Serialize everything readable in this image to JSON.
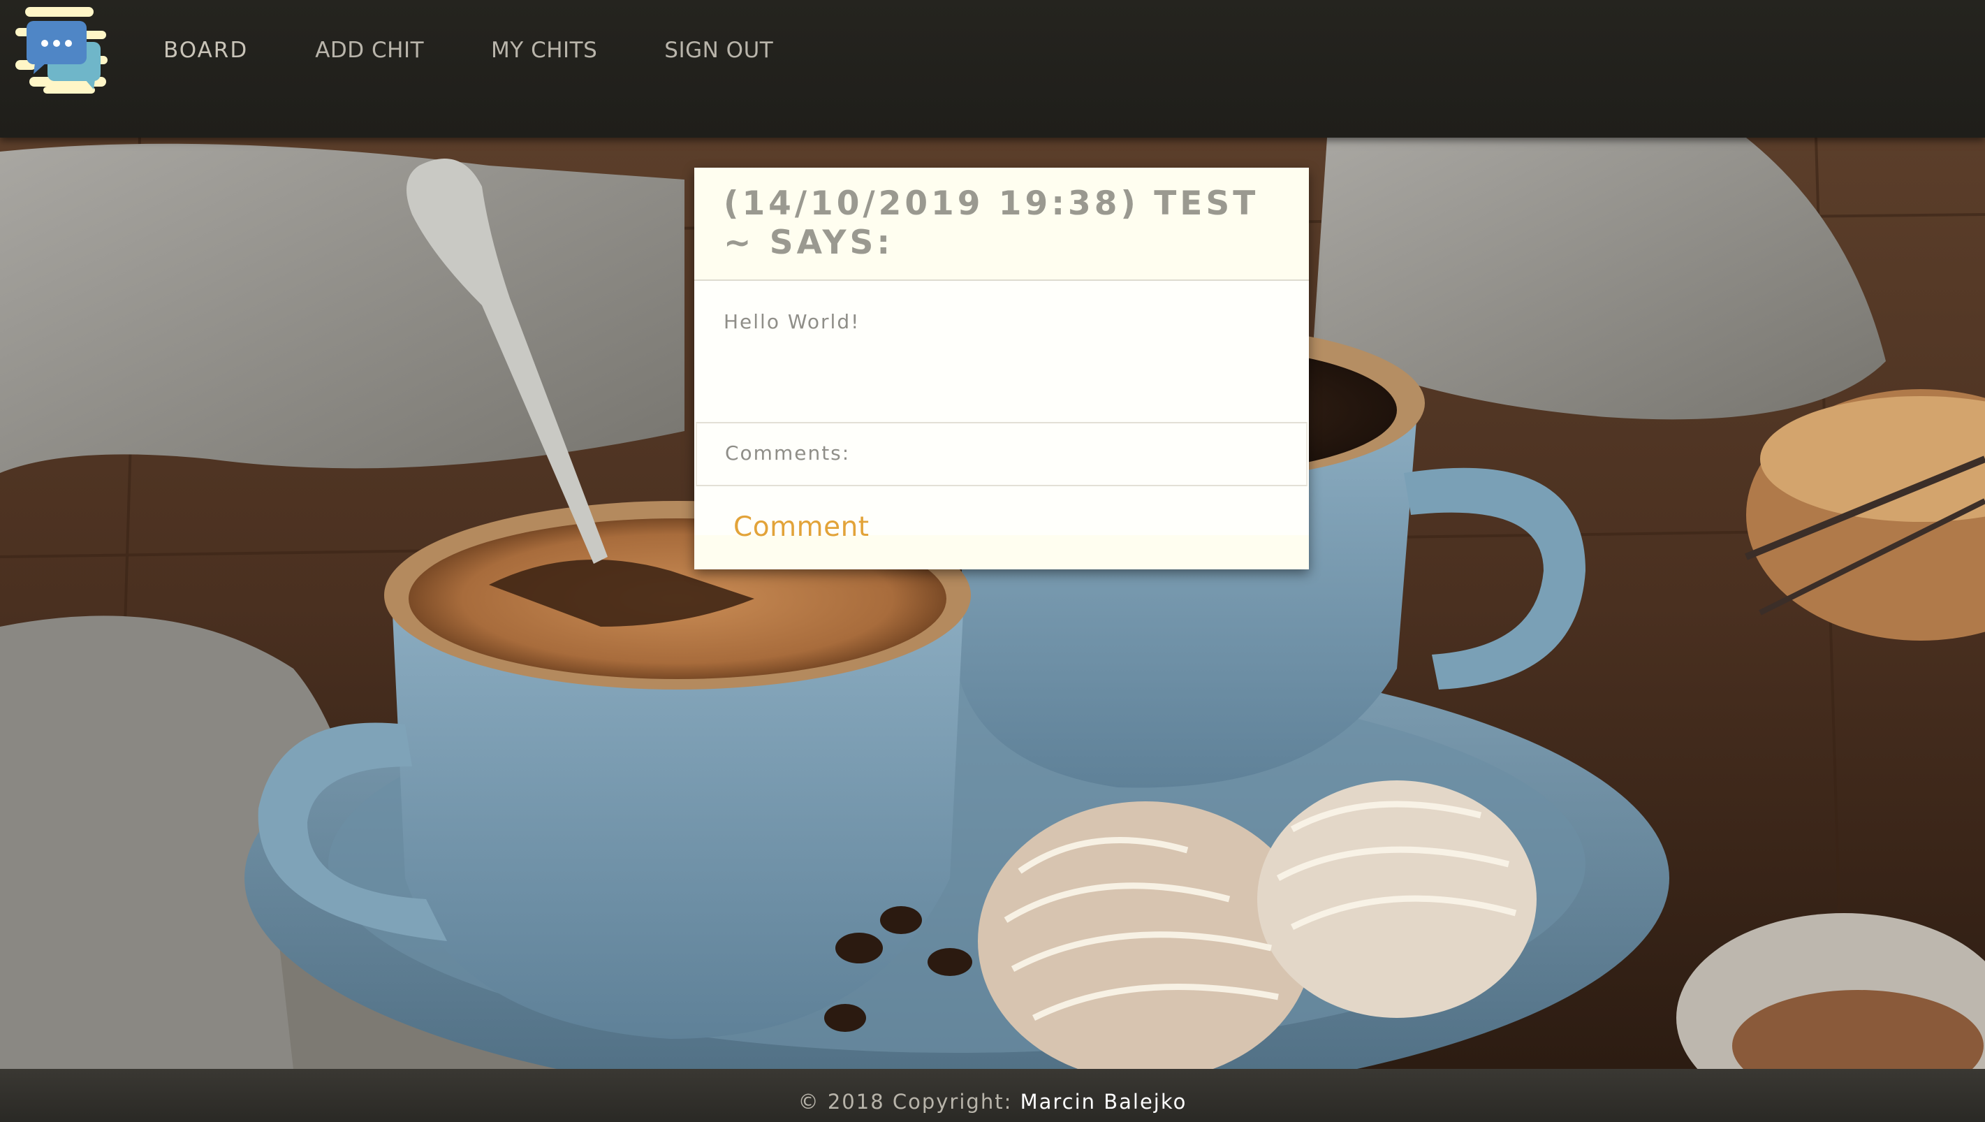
{
  "nav": {
    "logo_icon": "chat-bubbles-logo-icon",
    "items": [
      {
        "label": "BOARD"
      },
      {
        "label": "ADD CHIT"
      },
      {
        "label": "MY CHITS"
      },
      {
        "label": "SIGN OUT"
      }
    ]
  },
  "chit": {
    "title": "(14/10/2019 19:38) test ~ says:",
    "message": "Hello World!",
    "comments_label": "Comments:",
    "comment_button": "Comment"
  },
  "footer": {
    "prefix": "© 2018 Copyright: ",
    "author": "Marcin Balejko"
  },
  "colors": {
    "navbar": "#1f1e1a",
    "card": "#fffef0",
    "accent": "#e2a339",
    "footer": "#2a2925"
  }
}
